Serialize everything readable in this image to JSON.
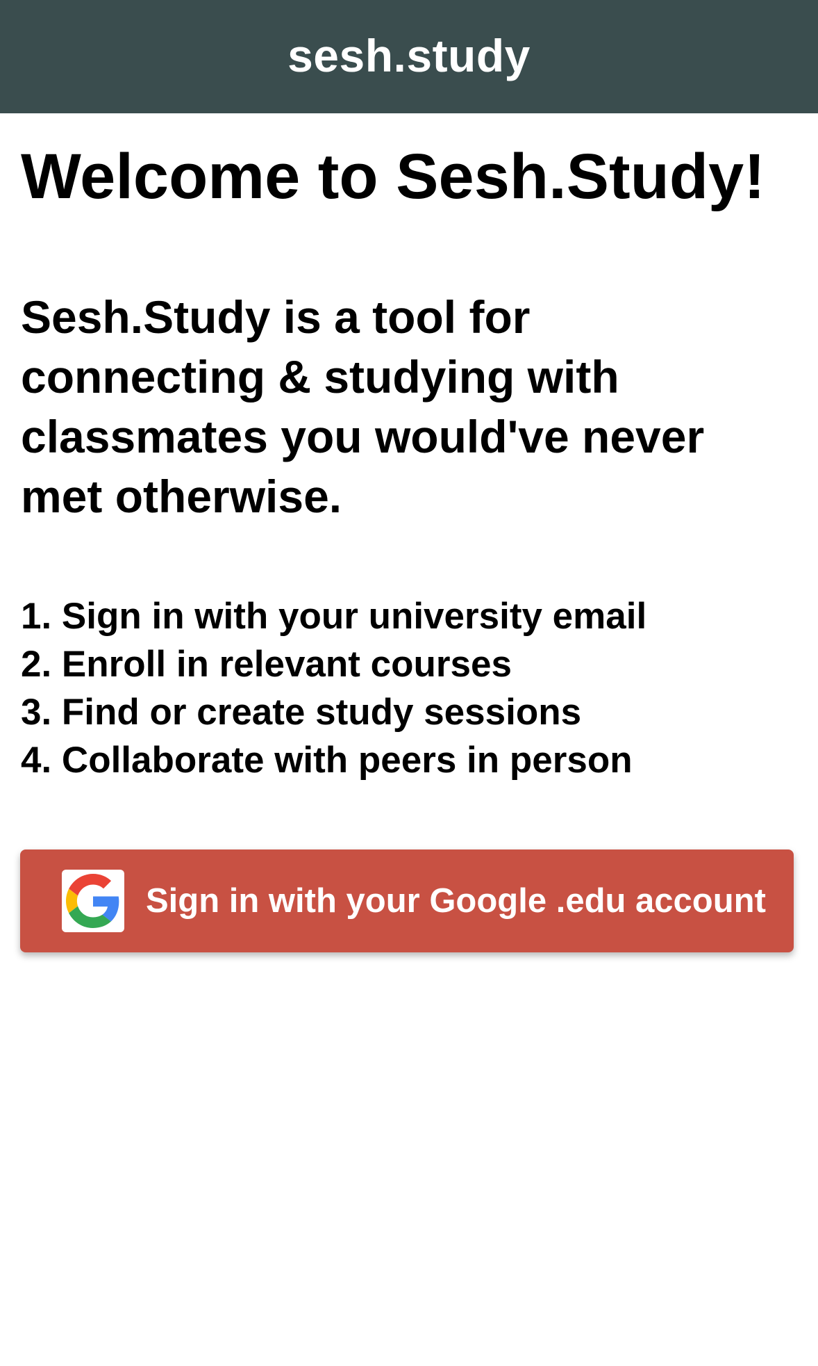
{
  "header": {
    "title": "sesh.study",
    "background_color": "#3a4d4e"
  },
  "main": {
    "welcome": "Welcome to Sesh.Study!",
    "intro": "Sesh.Study is a tool for connecting & studying with classmates you would've never met otherwise.",
    "steps": [
      "1. Sign in with your university email",
      "2. Enroll in relevant courses",
      "3. Find or create study sessions",
      "4. Collaborate with peers in person"
    ]
  },
  "signin_button": {
    "label": "Sign in with your Google .edu account",
    "icon": "google-icon",
    "background_color": "#c85143"
  }
}
